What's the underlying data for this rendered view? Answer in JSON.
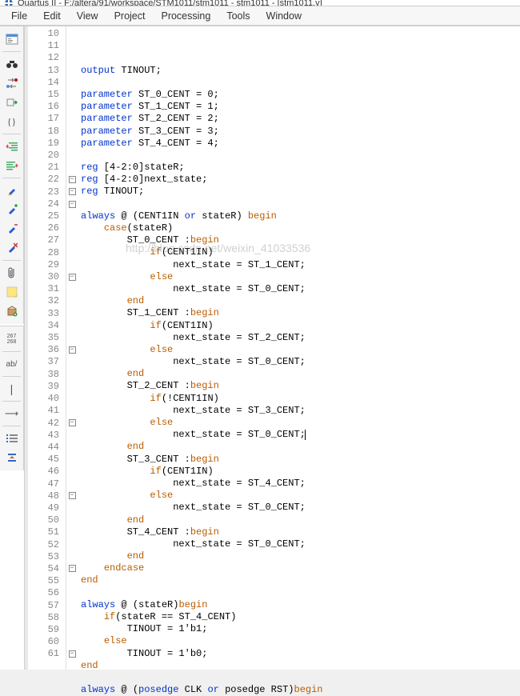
{
  "window": {
    "title": "Quartus II - F:/altera/91/workspace/STM1011/stm1011 - stm1011 - [stm1011.v]"
  },
  "menu": {
    "items": [
      "File",
      "Edit",
      "View",
      "Project",
      "Processing",
      "Tools",
      "Window"
    ]
  },
  "toolbar": {
    "doc_layout": "document-layout-icon",
    "find": "binoculars-icon",
    "replace": "replace-icon",
    "run": "run-arrow-icon",
    "braces": "{}",
    "indent_left": "indent-left-icon",
    "indent_right": "indent-right-icon",
    "bookmark_hl": "highlight-icon",
    "bookmark_add": "bookmark-add-icon",
    "bookmark_del": "bookmark-del-icon",
    "bookmark_clear": "bookmark-clear-icon",
    "attach": "paperclip-icon",
    "note": "note-icon",
    "package": "package-icon",
    "linecol": "267\n268",
    "ab": "ab/",
    "pipe": "|",
    "arrow_right": "→",
    "list": "list-icon",
    "collapse": "collapse-icon"
  },
  "editor": {
    "first_line": 10,
    "last_line": 61,
    "fold_lines": [
      22,
      23,
      24,
      30,
      36,
      42,
      48,
      54,
      61
    ],
    "watermark": "http://blog.csdn.net/weixin_41033536",
    "caret_line": 40,
    "lines": [
      {
        "n": 10,
        "t": "output TINOUT;",
        "kw": [
          "output"
        ]
      },
      {
        "n": 11,
        "t": ""
      },
      {
        "n": 12,
        "t": "parameter ST_0_CENT = 0;",
        "kw": [
          "parameter"
        ]
      },
      {
        "n": 13,
        "t": "parameter ST_1_CENT = 1;",
        "kw": [
          "parameter"
        ]
      },
      {
        "n": 14,
        "t": "parameter ST_2_CENT = 2;",
        "kw": [
          "parameter"
        ]
      },
      {
        "n": 15,
        "t": "parameter ST_3_CENT = 3;",
        "kw": [
          "parameter"
        ]
      },
      {
        "n": 16,
        "t": "parameter ST_4_CENT = 4;",
        "kw": [
          "parameter"
        ]
      },
      {
        "n": 17,
        "t": ""
      },
      {
        "n": 18,
        "t": "reg [4-2:0]stateR;",
        "kw": [
          "reg"
        ]
      },
      {
        "n": 19,
        "t": "reg [4-2:0]next_state;",
        "kw": [
          "reg"
        ]
      },
      {
        "n": 20,
        "t": "reg TINOUT;",
        "kw": [
          "reg"
        ]
      },
      {
        "n": 21,
        "t": ""
      },
      {
        "n": 22,
        "t": "always @ (CENT1IN or stateR) begin",
        "kw": [
          "always",
          "or"
        ],
        "ctl": [
          "begin"
        ]
      },
      {
        "n": 23,
        "t": "    case(stateR)",
        "ctl": [
          "case"
        ]
      },
      {
        "n": 24,
        "t": "        ST_0_CENT :begin",
        "ctl": [
          "begin"
        ]
      },
      {
        "n": 25,
        "t": "            if(CENT1IN)",
        "ctl": [
          "if"
        ]
      },
      {
        "n": 26,
        "t": "                next_state = ST_1_CENT;"
      },
      {
        "n": 27,
        "t": "            else",
        "ctl": [
          "else"
        ]
      },
      {
        "n": 28,
        "t": "                next_state = ST_0_CENT;"
      },
      {
        "n": 29,
        "t": "        end",
        "ctl": [
          "end"
        ]
      },
      {
        "n": 30,
        "t": "        ST_1_CENT :begin",
        "ctl": [
          "begin"
        ]
      },
      {
        "n": 31,
        "t": "            if(CENT1IN)",
        "ctl": [
          "if"
        ]
      },
      {
        "n": 32,
        "t": "                next_state = ST_2_CENT;"
      },
      {
        "n": 33,
        "t": "            else",
        "ctl": [
          "else"
        ]
      },
      {
        "n": 34,
        "t": "                next_state = ST_0_CENT;"
      },
      {
        "n": 35,
        "t": "        end",
        "ctl": [
          "end"
        ]
      },
      {
        "n": 36,
        "t": "        ST_2_CENT :begin",
        "ctl": [
          "begin"
        ]
      },
      {
        "n": 37,
        "t": "            if(!CENT1IN)",
        "ctl": [
          "if"
        ]
      },
      {
        "n": 38,
        "t": "                next_state = ST_3_CENT;"
      },
      {
        "n": 39,
        "t": "            else",
        "ctl": [
          "else"
        ]
      },
      {
        "n": 40,
        "t": "                next_state = ST_0_CENT;",
        "caret": true
      },
      {
        "n": 41,
        "t": "        end",
        "ctl": [
          "end"
        ]
      },
      {
        "n": 42,
        "t": "        ST_3_CENT :begin",
        "ctl": [
          "begin"
        ]
      },
      {
        "n": 43,
        "t": "            if(CENT1IN)",
        "ctl": [
          "if"
        ]
      },
      {
        "n": 44,
        "t": "                next_state = ST_4_CENT;"
      },
      {
        "n": 45,
        "t": "            else",
        "ctl": [
          "else"
        ]
      },
      {
        "n": 46,
        "t": "                next_state = ST_0_CENT;"
      },
      {
        "n": 47,
        "t": "        end",
        "ctl": [
          "end"
        ]
      },
      {
        "n": 48,
        "t": "        ST_4_CENT :begin",
        "ctl": [
          "begin"
        ]
      },
      {
        "n": 49,
        "t": "                next_state = ST_0_CENT;"
      },
      {
        "n": 50,
        "t": "        end",
        "ctl": [
          "end"
        ]
      },
      {
        "n": 51,
        "t": "    endcase",
        "ctl": [
          "endcase"
        ]
      },
      {
        "n": 52,
        "t": "end",
        "ctl": [
          "end"
        ]
      },
      {
        "n": 53,
        "t": ""
      },
      {
        "n": 54,
        "t": "always @ (stateR)begin",
        "kw": [
          "always"
        ],
        "ctl": [
          "begin"
        ]
      },
      {
        "n": 55,
        "t": "    if(stateR == ST_4_CENT)",
        "ctl": [
          "if"
        ]
      },
      {
        "n": 56,
        "t": "        TINOUT = 1'b1;"
      },
      {
        "n": 57,
        "t": "    else",
        "ctl": [
          "else"
        ]
      },
      {
        "n": 58,
        "t": "        TINOUT = 1'b0;"
      },
      {
        "n": 59,
        "t": "end",
        "ctl": [
          "end"
        ]
      },
      {
        "n": 60,
        "t": ""
      },
      {
        "n": 61,
        "t": "always @ (posedge CLK or posedge RST)begin",
        "kw": [
          "always",
          "posedge",
          "or",
          "posedge"
        ],
        "ctl": [
          "begin"
        ]
      }
    ]
  }
}
